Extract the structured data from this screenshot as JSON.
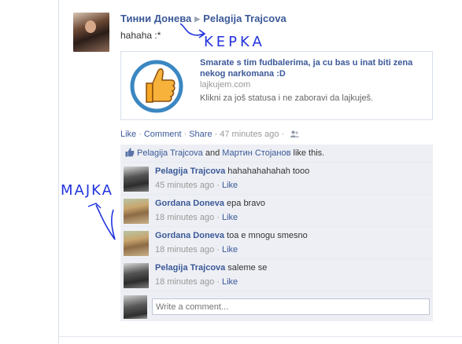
{
  "post": {
    "author": "Тинни Донева",
    "target": "Pelagija Trajcova",
    "status_text": "hahaha :*",
    "attachment": {
      "title": "Smarate s tim fudbalerima, ja cu bas u inat biti zena nekog narkomana :D",
      "domain": "lajkujem.com",
      "description": "Klikni za još statusa i ne zaboravi da lajkuješ."
    },
    "actions": {
      "like": "Like",
      "comment": "Comment",
      "share": "Share",
      "time": "47 minutes ago"
    }
  },
  "likes": {
    "person1": "Pelagija Trajcova",
    "and": "and",
    "person2": "Мартин Стојанов",
    "suffix": "like this."
  },
  "comments": [
    {
      "name": "Pelagija Trajcova",
      "text": "hahahahahahah tooo",
      "time": "45 minutes ago",
      "like": "Like"
    },
    {
      "name": "Gordana Doneva",
      "text": "epa bravo",
      "time": "18 minutes ago",
      "like": "Like"
    },
    {
      "name": "Gordana Doneva",
      "text": "toa e mnogu smesno",
      "time": "18 minutes ago",
      "like": "Like"
    },
    {
      "name": "Pelagija Trajcova",
      "text": "saleme se",
      "time": "18 minutes ago",
      "like": "Like"
    }
  ],
  "composer": {
    "placeholder": "Write a comment..."
  },
  "annotations": {
    "kepka": "KEPKA",
    "majka": "MAJKA"
  },
  "colors": {
    "link": "#3b5998",
    "comment_bg": "#edeff4",
    "annotation_ink": "#2233dd"
  }
}
